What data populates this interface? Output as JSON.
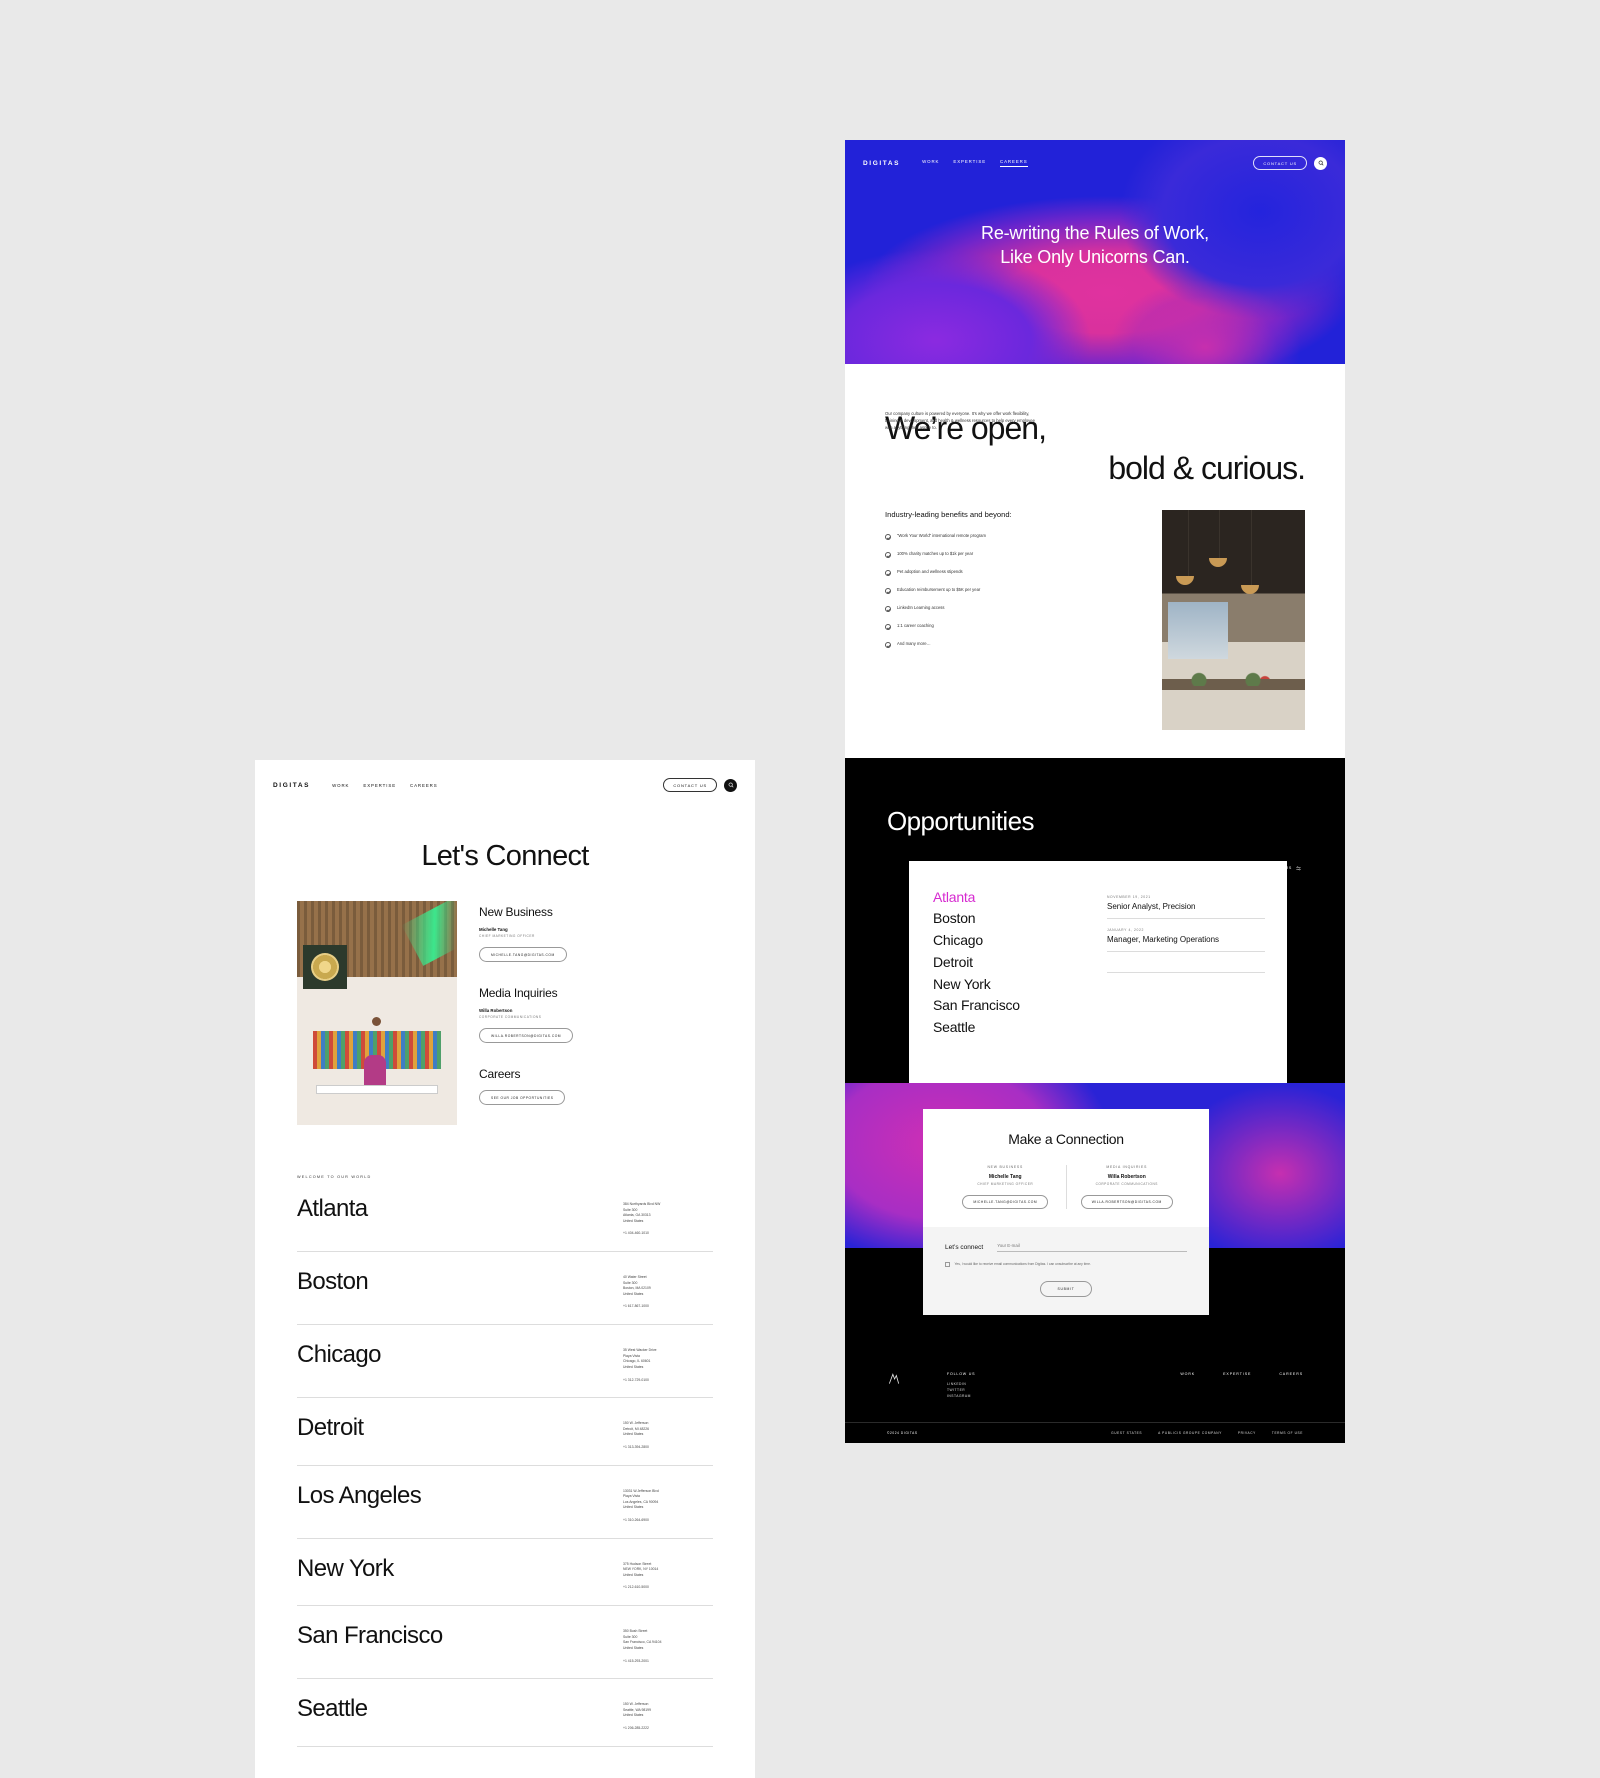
{
  "brand": {
    "logo": "DIGITAS",
    "accent": "#d62ad0"
  },
  "nav": {
    "links": [
      "WORK",
      "EXPERTISE",
      "CAREERS"
    ],
    "contact_label": "CONTACT US",
    "search_icon": "search-icon"
  },
  "careers_page": {
    "hero": {
      "line1": "Re-writing the Rules of Work,",
      "line2": "Like Only Unicorns Can."
    },
    "open": {
      "head1": "We’re open,",
      "head2": "bold & curious.",
      "body": "Our company culture is powered by everyone. It’s why we offer work flexibility, training & development, and health & wellness resources to help every employee with anything they aspire to.",
      "benefits_title": "Industry-leading benefits and beyond:",
      "benefits": [
        "“Work Your World” international remote program",
        "100% charity matches up to $1k per year",
        "Pet adoption and wellness stipends",
        "Education reimbursement up to $5K per year",
        "LinkedIn Learning access",
        "1:1 career coaching",
        "And many more…"
      ]
    },
    "opportunities": {
      "title": "Opportunities",
      "filter_label": "FILTERS",
      "cities": [
        "Atlanta",
        "Boston",
        "Chicago",
        "Detroit",
        "New York",
        "San Francisco",
        "Seattle"
      ],
      "selected_city": "Atlanta",
      "jobs": [
        {
          "date": "NOVEMBER 19, 2021",
          "title": "Senior Analyst, Precision"
        },
        {
          "date": "JANUARY 4, 2022",
          "title": "Manager, Marketing Operations"
        }
      ]
    },
    "connection": {
      "title": "Make a Connection",
      "columns": [
        {
          "label": "NEW BUSINESS",
          "name": "Michelle Tang",
          "role": "CHIEF MARKETING OFFICER",
          "email": "MICHELLE.TANG@DIGITAS.COM"
        },
        {
          "label": "MEDIA INQUIRIES",
          "name": "Willa Robertson",
          "role": "CORPORATE COMMUNICATIONS",
          "email": "WILLA.ROBERTSON@DIGITAS.COM"
        }
      ],
      "form_title": "Let’s connect",
      "email_placeholder": "Your E-mail",
      "consent": "Yes, I would like to receive email communications from Digitas. I can unsubscribe at any time.",
      "submit_label": "SUBMIT"
    },
    "footer": {
      "follow_title": "FOLLOW US",
      "socials": [
        "LINKEDIN",
        "TWITTER",
        "INSTAGRAM"
      ],
      "nav": [
        "WORK",
        "EXPERTISE",
        "CAREERS"
      ],
      "copyright": "©2024 DIGITAS",
      "links": [
        "GUEST STATES",
        "A PUBLICIS GROUPE COMPANY",
        "PRIVACY",
        "TERMS OF USE"
      ]
    }
  },
  "contact_page": {
    "title": "Let's Connect",
    "groups": [
      {
        "heading": "New Business",
        "name": "Michelle Tang",
        "role": "CHIEF MARKETING OFFICER",
        "button": "MICHELLE.TANG@DIGITAS.COM"
      },
      {
        "heading": "Media Inquiries",
        "name": "Willa Robertson",
        "role": "CORPORATE COMMUNICATIONS",
        "button": "WILLA.ROBERTSON@DIGITAS.COM"
      },
      {
        "heading": "Careers",
        "name": "",
        "role": "",
        "button": "SEE OUR JOB OPPORTUNITIES"
      }
    ],
    "welcome_label": "WELCOME TO OUR WORLD",
    "locations": [
      {
        "city": "Atlanta",
        "street": "384 Northyards Blvd NW",
        "suite": "Suite 300",
        "citystate": "Atlanta, GA 30313",
        "country": "United States",
        "tel": "+1 404-460-1010"
      },
      {
        "city": "Boston",
        "street": "40 Water Street",
        "suite": "Suite 300",
        "citystate": "Boston, MA 02109",
        "country": "United States",
        "tel": "+1 617-867-1000"
      },
      {
        "city": "Chicago",
        "street": "35 West Wacker Drive",
        "suite": "Playa Vista",
        "citystate": "Chicago, IL 60601",
        "country": "United States",
        "tel": "+1 312-729-0100"
      },
      {
        "city": "Detroit",
        "street": "150 W. Jefferson",
        "suite": "",
        "citystate": "Detroit, MI 48226",
        "country": "United States",
        "tel": "+1 313-394-2800"
      },
      {
        "city": "Los Angeles",
        "street": "13031 W.Jefferson Blvd",
        "suite": "Playa Vista",
        "citystate": "Los Angeles, CA 90094",
        "country": "United States",
        "tel": "+1 310-264-6900"
      },
      {
        "city": "New York",
        "street": "375 Hudson Street",
        "suite": "",
        "citystate": "NEW YORK, NY 10014",
        "country": "United States",
        "tel": "+1 212-610-5000"
      },
      {
        "city": "San Francisco",
        "street": "350 Bush Street",
        "suite": "Suite 300",
        "citystate": "San Francisco, CA 94104",
        "country": "United States",
        "tel": "+1 415-293-2001"
      },
      {
        "city": "Seattle",
        "street": "150 W. Jefferson",
        "suite": "",
        "citystate": "Seattle, WA 98199",
        "country": "United States",
        "tel": "+1 206-285-2222"
      }
    ]
  }
}
